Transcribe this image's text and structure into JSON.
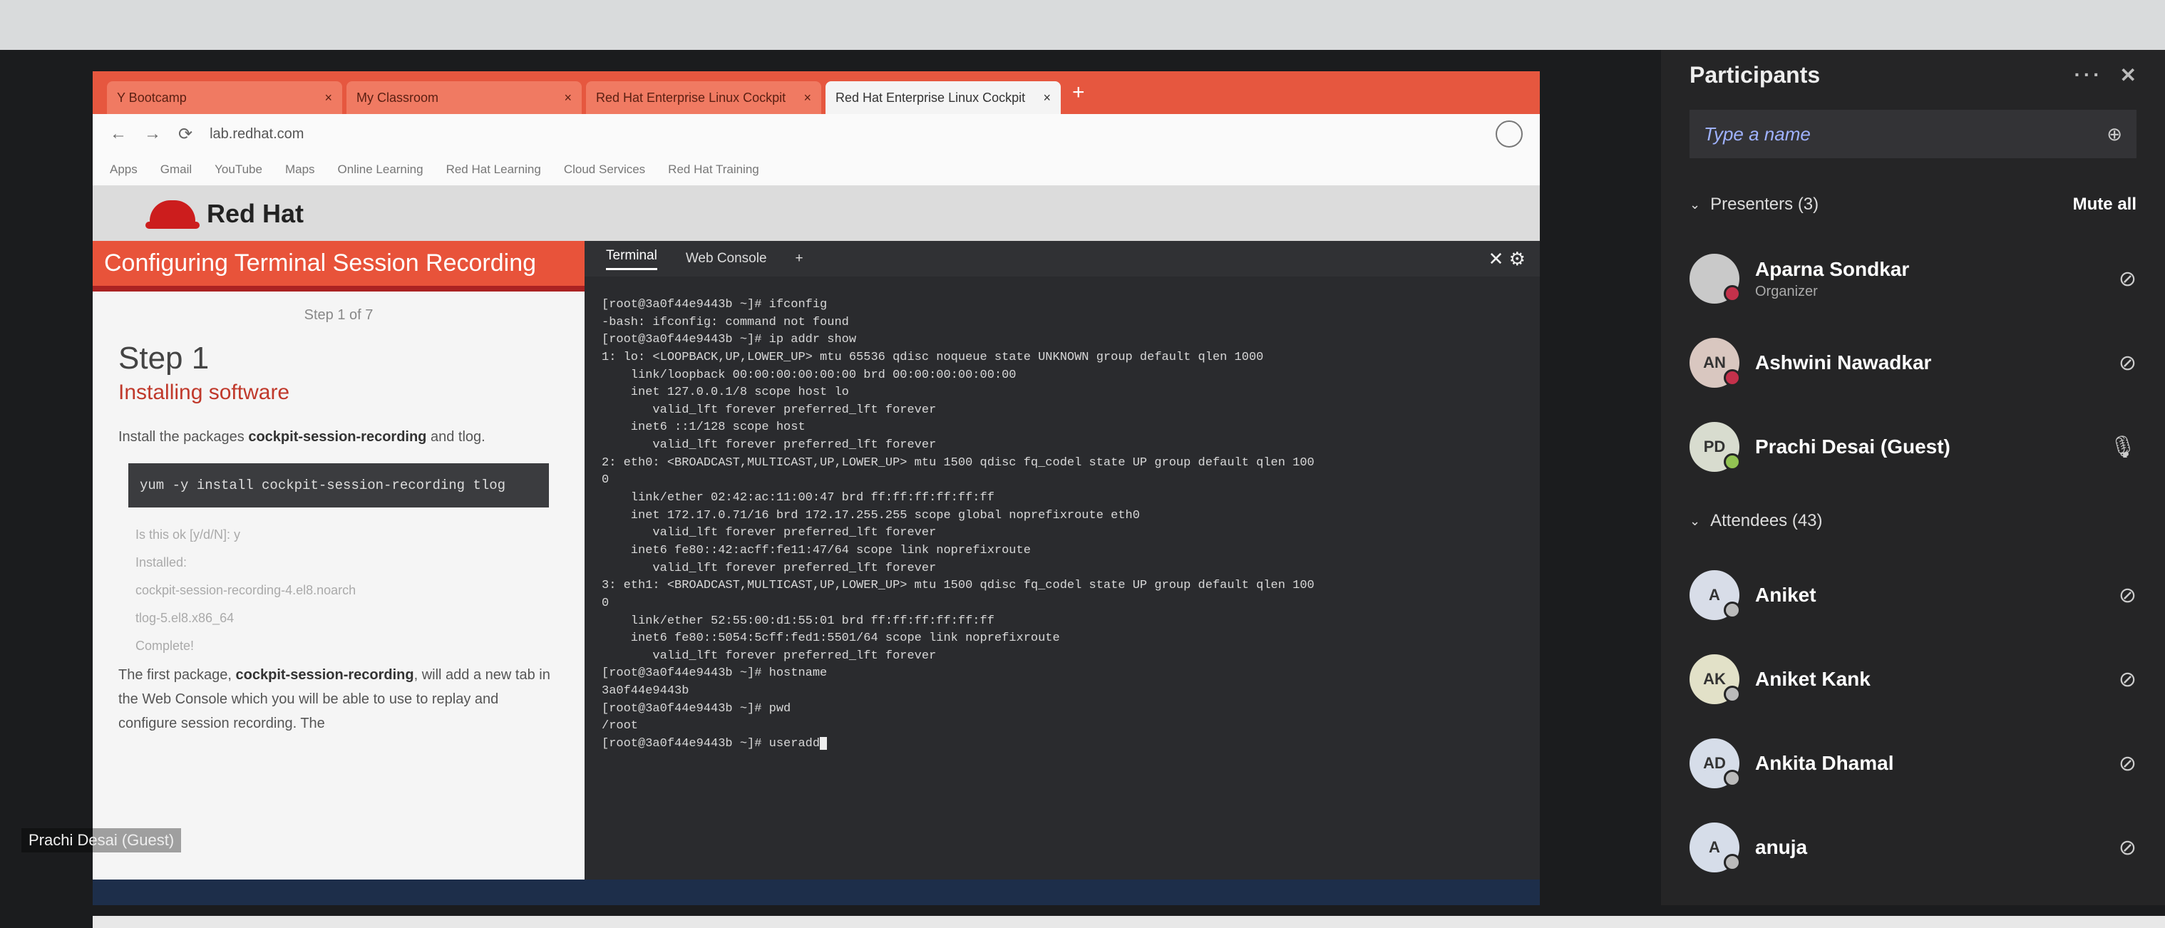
{
  "browser": {
    "tabs": [
      {
        "label": "Y Bootcamp",
        "active": false
      },
      {
        "label": "My Classroom",
        "active": false
      },
      {
        "label": "Red Hat Enterprise Linux Cockpit",
        "active": false
      },
      {
        "label": "Red Hat Enterprise Linux Cockpit",
        "active": true
      }
    ],
    "new_tab": "+",
    "address": "lab.redhat.com",
    "bookmarks": [
      "Apps",
      "Gmail",
      "YouTube",
      "Maps",
      "Online Learning",
      "Red Hat Learning",
      "Cloud Services",
      "Red Hat Training"
    ]
  },
  "redhat": {
    "brand": "Red Hat"
  },
  "guide": {
    "title": "Configuring Terminal Session Recording",
    "step_count": "Step 1 of 7",
    "step_heading": "Step 1",
    "step_subtitle": "Installing software",
    "intro_prefix": "Install the packages ",
    "intro_pkg": "cockpit-session-recording",
    "intro_suffix": " and tlog.",
    "command": "yum -y install cockpit-session-recording tlog",
    "output_line1": "Is this ok [y/d/N]: y",
    "output_line2": "Installed:",
    "output_line3": "cockpit-session-recording-4.el8.noarch",
    "output_line4": "tlog-5.el8.x86_64",
    "output_line5": "Complete!",
    "body_prefix": "The first package, ",
    "body_pkg": "cockpit-session-recording",
    "body_suffix": ", will add a new tab in the Web Console which you will be able to use to replay and configure session recording. The"
  },
  "console": {
    "tabs": [
      "Terminal",
      "Web Console"
    ],
    "tools": "✕ ⚙",
    "lines": [
      "[root@3a0f44e9443b ~]# ifconfig",
      "-bash: ifconfig: command not found",
      "[root@3a0f44e9443b ~]# ip addr show",
      "1: lo: <LOOPBACK,UP,LOWER_UP> mtu 65536 qdisc noqueue state UNKNOWN group default qlen 1000",
      "    link/loopback 00:00:00:00:00:00 brd 00:00:00:00:00:00",
      "    inet 127.0.0.1/8 scope host lo",
      "       valid_lft forever preferred_lft forever",
      "    inet6 ::1/128 scope host",
      "       valid_lft forever preferred_lft forever",
      "2: eth0: <BROADCAST,MULTICAST,UP,LOWER_UP> mtu 1500 qdisc fq_codel state UP group default qlen 100",
      "0",
      "    link/ether 02:42:ac:11:00:47 brd ff:ff:ff:ff:ff:ff",
      "    inet 172.17.0.71/16 brd 172.17.255.255 scope global noprefixroute eth0",
      "       valid_lft forever preferred_lft forever",
      "    inet6 fe80::42:acff:fe11:47/64 scope link noprefixroute",
      "       valid_lft forever preferred_lft forever",
      "3: eth1: <BROADCAST,MULTICAST,UP,LOWER_UP> mtu 1500 qdisc fq_codel state UP group default qlen 100",
      "0",
      "    link/ether 52:55:00:d1:55:01 brd ff:ff:ff:ff:ff:ff",
      "    inet6 fe80::5054:5cff:fed1:5501/64 scope link noprefixroute",
      "       valid_lft forever preferred_lft forever",
      "[root@3a0f44e9443b ~]# hostname",
      "3a0f44e9443b",
      "[root@3a0f44e9443b ~]# pwd",
      "/root",
      "[root@3a0f44e9443b ~]# useradd"
    ]
  },
  "presenter_name": "Prachi Desai (Guest)",
  "participants": {
    "title": "Participants",
    "more": "···",
    "close": "✕",
    "search_placeholder": "Type a name",
    "presenters_label": "Presenters (3)",
    "mute_all": "Mute all",
    "attendees_label": "Attendees (43)",
    "presenters": [
      {
        "name": "Aparna Sondkar",
        "role": "Organizer",
        "initials": "",
        "avatar_color": "#c9c9c9",
        "status_color": "#c4314b",
        "mic": "mic-off-icon"
      },
      {
        "name": "Ashwini Nawadkar",
        "role": "",
        "initials": "AN",
        "avatar_color": "#d9c7c0",
        "status_color": "#c4314b",
        "mic": "mic-off-icon"
      },
      {
        "name": "Prachi Desai (Guest)",
        "role": "",
        "initials": "PD",
        "avatar_color": "#d8dccf",
        "status_color": "#92c353",
        "mic": "mic-on-icon"
      }
    ],
    "attendees": [
      {
        "name": "Aniket",
        "role": "",
        "initials": "A",
        "avatar_color": "#d8dde8",
        "status_color": "#bbbbbb",
        "mic": "mic-off-icon"
      },
      {
        "name": "Aniket Kank",
        "role": "",
        "initials": "AK",
        "avatar_color": "#e2e1c8",
        "status_color": "#bbbbbb",
        "mic": "mic-off-icon"
      },
      {
        "name": "Ankita Dhamal",
        "role": "",
        "initials": "AD",
        "avatar_color": "#d6dde9",
        "status_color": "#bbbbbb",
        "mic": "mic-off-icon"
      },
      {
        "name": "anuja",
        "role": "",
        "initials": "A",
        "avatar_color": "#d6dde9",
        "status_color": "#bbbbbb",
        "mic": "mic-off-icon"
      }
    ]
  }
}
